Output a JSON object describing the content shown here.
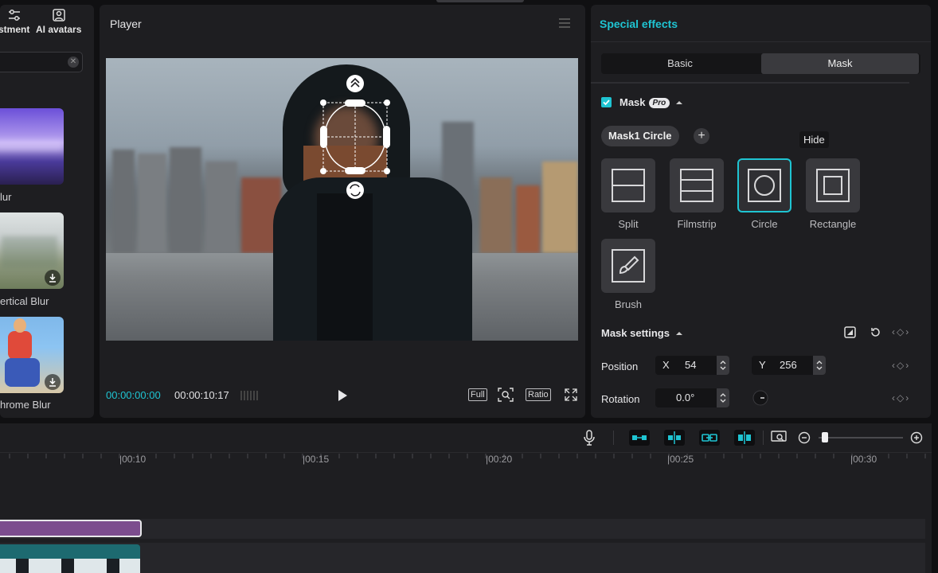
{
  "left_panel": {
    "tabs": [
      {
        "label": "stment",
        "icon": "adjustment-icon"
      },
      {
        "label": "AI avatars",
        "icon": "ai-avatar-icon"
      }
    ],
    "effects": [
      {
        "label": "lur"
      },
      {
        "label": "ertical Blur"
      },
      {
        "label": "hrome Blur"
      }
    ]
  },
  "player": {
    "title": "Player",
    "time_current": "00:00:00:00",
    "time_total": "00:00:10:17",
    "full_label": "Full",
    "ratio_label": "Ratio"
  },
  "right_panel": {
    "title": "Special effects",
    "tabs": [
      "Basic",
      "Mask"
    ],
    "active_tab": "Mask",
    "mask_label": "Mask",
    "pro_badge": "Pro",
    "mask_chip": "Mask1 Circle",
    "tooltip": "Hide",
    "mask_types": [
      "Split",
      "Filmstrip",
      "Circle",
      "Rectangle",
      "Brush"
    ],
    "selected_mask": "Circle",
    "settings_title": "Mask settings",
    "position_label": "Position",
    "x_label": "X",
    "x_value": "54",
    "y_label": "Y",
    "y_value": "256",
    "rotation_label": "Rotation",
    "rotation_value": "0.0°"
  },
  "timeline": {
    "ticks": [
      "|00:10",
      "|00:15",
      "|00:20",
      "|00:25",
      "|00:30"
    ]
  },
  "colors": {
    "accent": "#1fc4d2",
    "panel": "#1e1e21",
    "clip_purple": "#7c4d8e",
    "clip_video": "#1d6a70"
  }
}
